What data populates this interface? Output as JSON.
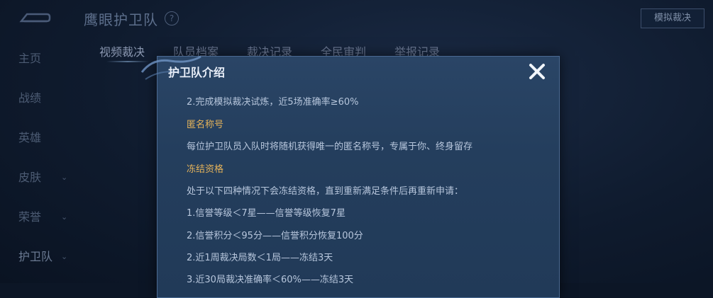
{
  "header": {
    "title": "鹰眼护卫队",
    "help_icon": "?",
    "sim_button": "模拟裁决"
  },
  "sidebar": {
    "items": [
      {
        "label": "主页",
        "has_chevron": false
      },
      {
        "label": "战绩",
        "has_chevron": false
      },
      {
        "label": "英雄",
        "has_chevron": false
      },
      {
        "label": "皮肤",
        "has_chevron": true
      },
      {
        "label": "荣誉",
        "has_chevron": true
      },
      {
        "label": "护卫队",
        "has_chevron": true
      }
    ],
    "chevron": "⌄"
  },
  "tabs": [
    {
      "label": "视频裁决",
      "active": true
    },
    {
      "label": "队员档案",
      "active": false
    },
    {
      "label": "裁决记录",
      "active": false
    },
    {
      "label": "全民审判",
      "active": false
    },
    {
      "label": "举报记录",
      "active": false
    }
  ],
  "modal": {
    "title": "护卫队介绍",
    "close_icon": "✕",
    "lines": [
      {
        "text": "2.完成模拟裁决试炼，近5场准确率≥60%",
        "type": "body"
      },
      {
        "text": "匿名称号",
        "type": "heading"
      },
      {
        "text": "每位护卫队员入队时将随机获得唯一的匿名称号，专属于你、终身留存",
        "type": "body"
      },
      {
        "text": "冻结资格",
        "type": "heading"
      },
      {
        "text": "处于以下四种情况下会冻结资格，直到重新满足条件后再重新申请：",
        "type": "body"
      },
      {
        "text": "1.信誉等级＜7星——信誉等级恢复7星",
        "type": "body"
      },
      {
        "text": "2.信誉积分＜95分——信誉积分恢复100分",
        "type": "body"
      },
      {
        "text": "2.近1周裁决局数＜1局——冻结3天",
        "type": "body"
      },
      {
        "text": "3.近30局裁决准确率＜60%——冻结3天",
        "type": "body"
      }
    ]
  },
  "colors": {
    "heading": "#e5b35a",
    "body_text": "#b7c6dc",
    "modal_bg": "#243e5d"
  }
}
